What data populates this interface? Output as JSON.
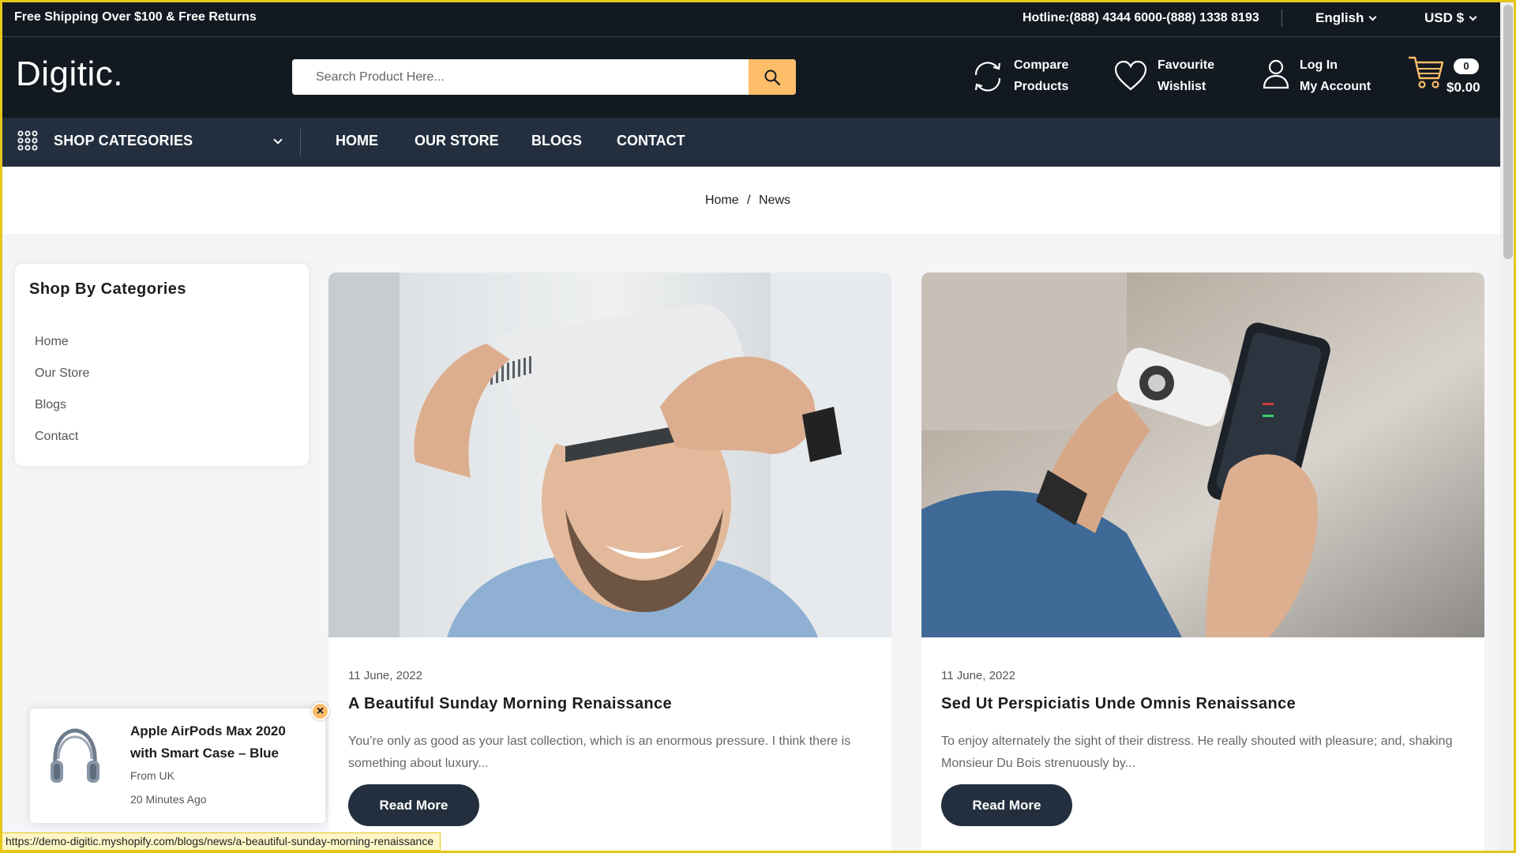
{
  "topbar": {
    "promo": "Free Shipping Over $100 & Free Returns",
    "hotline": "Hotline:(888) 4344 6000-(888) 1338 8193",
    "language": "English",
    "currency": "USD $"
  },
  "header": {
    "logo": "Digitic.",
    "search_placeholder": "Search Product Here...",
    "compare_line1": "Compare",
    "compare_line2": "Products",
    "wishlist_line1": "Favourite",
    "wishlist_line2": "Wishlist",
    "account_line1": "Log In",
    "account_line2": "My Account",
    "cart_count": "0",
    "cart_total": "$0.00"
  },
  "nav": {
    "categories_label": "SHOP CATEGORIES",
    "items": [
      "HOME",
      "OUR STORE",
      "BLOGS",
      "CONTACT"
    ]
  },
  "breadcrumb": {
    "home": "Home",
    "separator": "/",
    "current": "News"
  },
  "sidebar": {
    "title": "Shop By Categories",
    "items": [
      "Home",
      "Our Store",
      "Blogs",
      "Contact"
    ]
  },
  "posts": [
    {
      "date": "11 June, 2022",
      "title": "A Beautiful Sunday Morning Renaissance",
      "excerpt": "You’re only as good as your last collection, which is an enormous pressure. I think there is something about luxury...",
      "button": "Read More"
    },
    {
      "date": "11 June, 2022",
      "title": "Sed Ut Perspiciatis Unde Omnis Renaissance",
      "excerpt": "To enjoy alternately the sight of their distress. He really shouted with pleasure; and, shaking Monsieur Du Bois strenuously by...",
      "button": "Read More"
    }
  ],
  "popup": {
    "product": "Apple AirPods Max 2020 with Smart Case – Blue",
    "from": "From UK",
    "time": "20 Minutes Ago",
    "close": "×"
  },
  "status_url": "https://demo-digitic.myshopify.com/blogs/news/a-beautiful-sunday-morning-renaissance",
  "colors": {
    "header_bg": "#131921",
    "nav_bg": "#232f3e",
    "accent": "#febd69"
  }
}
